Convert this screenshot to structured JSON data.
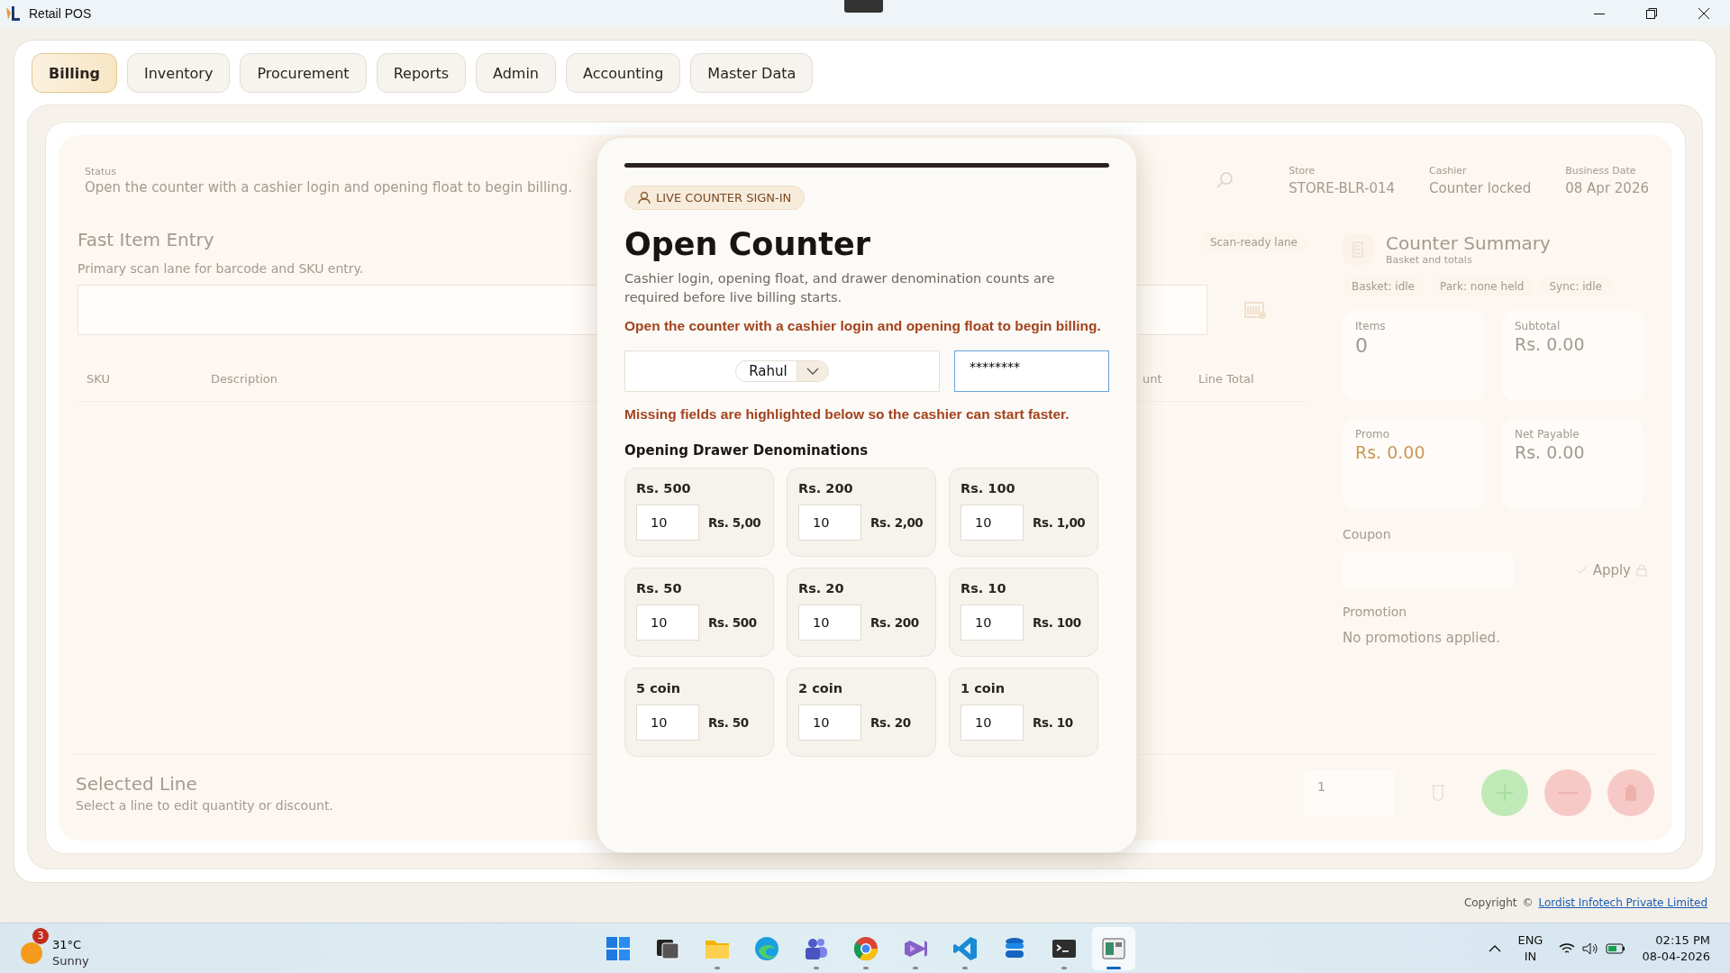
{
  "window": {
    "title": "Retail POS"
  },
  "tabs": [
    {
      "label": "Billing",
      "selected": true
    },
    {
      "label": "Inventory",
      "selected": false
    },
    {
      "label": "Procurement",
      "selected": false
    },
    {
      "label": "Reports",
      "selected": false
    },
    {
      "label": "Admin",
      "selected": false
    },
    {
      "label": "Accounting",
      "selected": false
    },
    {
      "label": "Master Data",
      "selected": false
    }
  ],
  "billing": {
    "status_label": "Status",
    "status_text": "Open the counter with a cashier login and opening float to begin billing.",
    "header_facts": [
      {
        "label": "Store",
        "value": "STORE-BLR-014"
      },
      {
        "label": "Cashier",
        "value": "Counter locked"
      },
      {
        "label": "Business Date",
        "value": "08 Apr 2026"
      }
    ],
    "entry_title": "Fast Item Entry",
    "entry_subtitle": "Primary scan lane for barcode and SKU entry.",
    "lane_chip": "Scan-ready lane",
    "columns": [
      "SKU",
      "Description",
      "unt",
      "Line Total"
    ],
    "summary": {
      "title": "Counter Summary",
      "subtitle": "Basket and totals",
      "chips": [
        "Basket: idle",
        "Park: none held",
        "Sync: idle"
      ],
      "stats": [
        {
          "label": "Items",
          "value": "0",
          "kind": "count"
        },
        {
          "label": "Subtotal",
          "value": "Rs. 0.00",
          "kind": "amount"
        },
        {
          "label": "Promo",
          "value": "Rs. 0.00",
          "kind": "promo"
        },
        {
          "label": "Net Payable",
          "value": "Rs. 0.00",
          "kind": "total"
        }
      ],
      "coupon_label": "Coupon",
      "apply_label": "Apply",
      "promotion_label": "Promotion",
      "promotion_text": "No promotions applied."
    },
    "selected_title": "Selected Line",
    "selected_subtitle": "Select a line to edit quantity or discount.",
    "quantity": "1"
  },
  "dialog": {
    "badge": "LIVE COUNTER SIGN-IN",
    "title": "Open Counter",
    "description": "Cashier login, opening float, and drawer denomination counts are required before live billing starts.",
    "notice": "Open the counter with a cashier login and opening float to begin billing.",
    "cashier": "Rahul",
    "pin": {
      "value": "********",
      "focused": true
    },
    "hint": "Missing fields are highlighted below so the cashier can start faster.",
    "section_title": "Opening Drawer Denominations",
    "denominations": [
      {
        "label": "Rs. 500",
        "count": "10",
        "amount": "Rs. 5,00"
      },
      {
        "label": "Rs. 200",
        "count": "10",
        "amount": "Rs. 2,00"
      },
      {
        "label": "Rs. 100",
        "count": "10",
        "amount": "Rs. 1,00"
      },
      {
        "label": "Rs. 50",
        "count": "10",
        "amount": "Rs. 500"
      },
      {
        "label": "Rs. 20",
        "count": "10",
        "amount": "Rs. 200"
      },
      {
        "label": "Rs. 10",
        "count": "10",
        "amount": "Rs. 100"
      },
      {
        "label": "5 coin",
        "count": "10",
        "amount": "Rs. 50"
      },
      {
        "label": "2 coin",
        "count": "10",
        "amount": "Rs. 20"
      },
      {
        "label": "1 coin",
        "count": "10",
        "amount": "Rs. 10"
      }
    ]
  },
  "footer": {
    "copyright": "Copyright",
    "symbol": "©",
    "link": "Lordist Infotech Private Limited"
  },
  "taskbar": {
    "weather_badge": "3",
    "temperature": "31°C",
    "condition": "Sunny",
    "apps": [
      {
        "kind": "start",
        "running": false,
        "active": false
      },
      {
        "kind": "taskview",
        "running": false,
        "active": false
      },
      {
        "kind": "folder",
        "running": true,
        "active": false
      },
      {
        "kind": "browser-wave",
        "running": false,
        "active": false
      },
      {
        "kind": "people",
        "running": true,
        "active": false
      },
      {
        "kind": "browser-ring",
        "running": true,
        "active": false
      },
      {
        "kind": "studio",
        "running": true,
        "active": false
      },
      {
        "kind": "code",
        "running": true,
        "active": false
      },
      {
        "kind": "database",
        "running": false,
        "active": false
      },
      {
        "kind": "terminal",
        "running": true,
        "active": false
      },
      {
        "kind": "pos",
        "running": true,
        "active": true
      }
    ],
    "language": "ENG",
    "region": "IN",
    "time": "02:15 PM",
    "date": "08-04-2026"
  }
}
